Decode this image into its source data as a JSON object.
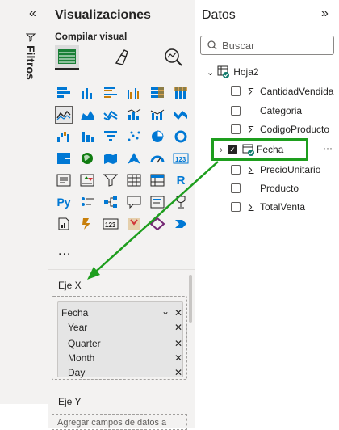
{
  "filtros": {
    "label": "Filtros"
  },
  "viz": {
    "title": "Visualizaciones",
    "subtitle": "Compilar visual",
    "more": "...",
    "wells": {
      "x_label": "Eje X",
      "x_field": "Fecha",
      "x_children": [
        "Year",
        "Quarter",
        "Month",
        "Day"
      ],
      "y_label": "Eje Y",
      "y_placeholder": "Agregar campos de datos a"
    }
  },
  "datos": {
    "title": "Datos",
    "search_placeholder": "Buscar",
    "table": "Hoja2",
    "fields": [
      {
        "name": "CantidadVendida",
        "sigma": true,
        "checked": false
      },
      {
        "name": "Categoria",
        "sigma": false,
        "checked": false
      },
      {
        "name": "CodigoProducto",
        "sigma": true,
        "checked": false
      },
      {
        "name": "Fecha",
        "sigma": false,
        "checked": true
      },
      {
        "name": "PrecioUnitario",
        "sigma": true,
        "checked": false
      },
      {
        "name": "Producto",
        "sigma": false,
        "checked": false
      },
      {
        "name": "TotalVenta",
        "sigma": true,
        "checked": false
      }
    ],
    "more_options": "···"
  },
  "colors": {
    "highlight": "#1e9e1e",
    "accent": "#0078d4"
  }
}
